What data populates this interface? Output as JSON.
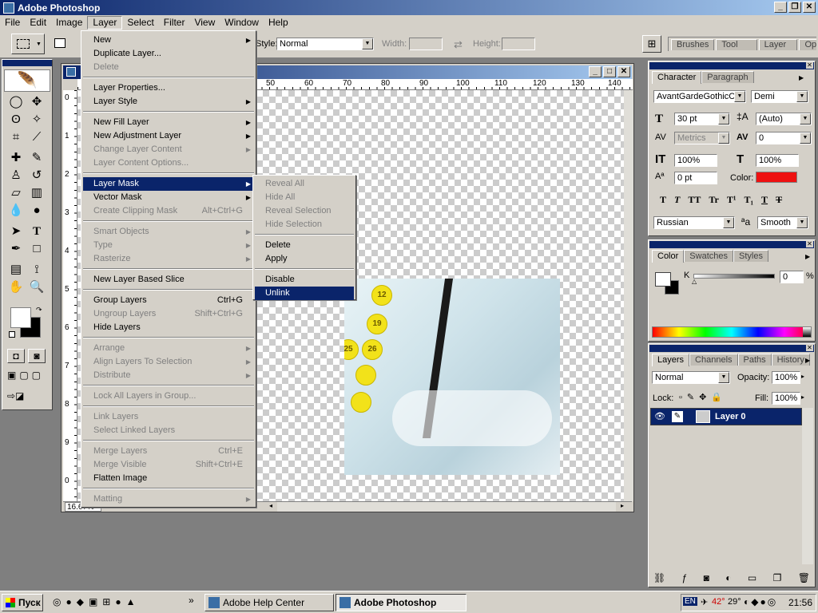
{
  "app": {
    "title": "Adobe Photoshop"
  },
  "menubar": [
    "File",
    "Edit",
    "Image",
    "Layer",
    "Select",
    "Filter",
    "View",
    "Window",
    "Help"
  ],
  "options": {
    "style_label": "Style:",
    "style_value": "Normal",
    "width_label": "Width:",
    "height_label": "Height:",
    "palette_tabs": [
      "Brushes",
      "Tool Presets",
      "Layer Comps",
      "Options"
    ]
  },
  "layer_menu": {
    "items": [
      {
        "label": "New",
        "arrow": true
      },
      {
        "label": "Duplicate Layer..."
      },
      {
        "label": "Delete",
        "disabled": true
      },
      {
        "label": "Layer Properties..."
      },
      {
        "label": "Layer Style",
        "arrow": true
      },
      {
        "label": "New Fill Layer",
        "arrow": true
      },
      {
        "label": "New Adjustment Layer",
        "arrow": true
      },
      {
        "label": "Change Layer Content",
        "disabled": true,
        "arrow": true
      },
      {
        "label": "Layer Content Options...",
        "disabled": true
      },
      {
        "label": "Layer Mask",
        "arrow": true,
        "highlight": true
      },
      {
        "label": "Vector Mask",
        "arrow": true
      },
      {
        "label": "Create Clipping Mask",
        "disabled": true,
        "shortcut": "Alt+Ctrl+G"
      },
      {
        "label": "Smart Objects",
        "disabled": true,
        "arrow": true
      },
      {
        "label": "Type",
        "disabled": true,
        "arrow": true
      },
      {
        "label": "Rasterize",
        "disabled": true,
        "arrow": true
      },
      {
        "label": "New Layer Based Slice"
      },
      {
        "label": "Group Layers",
        "shortcut": "Ctrl+G"
      },
      {
        "label": "Ungroup Layers",
        "disabled": true,
        "shortcut": "Shift+Ctrl+G"
      },
      {
        "label": "Hide Layers"
      },
      {
        "label": "Arrange",
        "disabled": true,
        "arrow": true
      },
      {
        "label": "Align Layers To Selection",
        "disabled": true,
        "arrow": true
      },
      {
        "label": "Distribute",
        "disabled": true,
        "arrow": true
      },
      {
        "label": "Lock All Layers in Group...",
        "disabled": true
      },
      {
        "label": "Link Layers",
        "disabled": true
      },
      {
        "label": "Select Linked Layers",
        "disabled": true
      },
      {
        "label": "Merge Layers",
        "disabled": true,
        "shortcut": "Ctrl+E"
      },
      {
        "label": "Merge Visible",
        "disabled": true,
        "shortcut": "Shift+Ctrl+E"
      },
      {
        "label": "Flatten Image"
      },
      {
        "label": "Matting",
        "disabled": true,
        "arrow": true
      }
    ]
  },
  "mask_submenu": {
    "items": [
      {
        "label": "Reveal All",
        "disabled": true
      },
      {
        "label": "Hide All",
        "disabled": true
      },
      {
        "label": "Reveal Selection",
        "disabled": true
      },
      {
        "label": "Hide Selection",
        "disabled": true
      },
      {
        "label": "Delete"
      },
      {
        "label": "Apply"
      },
      {
        "label": "Disable"
      },
      {
        "label": "Unlink",
        "highlight": true
      }
    ]
  },
  "document": {
    "zoom": "16.67%",
    "status": "Scratch: 223.9M/33 1.0M",
    "ruler_top": [
      "50",
      "60",
      "70",
      "80",
      "90",
      "100",
      "110",
      "120",
      "130",
      "140"
    ],
    "ruler_left": [
      "0",
      "1",
      "2",
      "3",
      "4",
      "5",
      "6",
      "7",
      "8",
      "9",
      "0"
    ],
    "dots": [
      "12",
      "19",
      "25",
      "26"
    ]
  },
  "character": {
    "tabs": [
      "Character",
      "Paragraph"
    ],
    "font": "AvantGardeGothicC",
    "style": "Demi",
    "size": "30 pt",
    "leading": "(Auto)",
    "kerning": "Metrics",
    "tracking": "0",
    "vscale": "100%",
    "hscale": "100%",
    "baseline": "0 pt",
    "color_label": "Color:",
    "color": "#ee1111",
    "styles": [
      "T",
      "T",
      "TT",
      "Tr",
      "T¹",
      "T₁",
      "T",
      "T"
    ],
    "language": "Russian",
    "aa_label": "ªa",
    "antialias": "Smooth"
  },
  "color_panel": {
    "tabs": [
      "Color",
      "Swatches",
      "Styles"
    ],
    "channel": "K",
    "value": "0",
    "unit": "%"
  },
  "layers": {
    "tabs": [
      "Layers",
      "Channels",
      "Paths",
      "History"
    ],
    "blend": "Normal",
    "opacity_label": "Opacity:",
    "opacity": "100%",
    "lock_label": "Lock:",
    "fill_label": "Fill:",
    "fill": "100%",
    "layer_name": "Layer 0"
  },
  "taskbar": {
    "start": "Пуск",
    "tasks": [
      "Adobe Help Center",
      "Adobe Photoshop"
    ],
    "lang": "EN",
    "tray_temps": [
      "42°",
      "29°"
    ],
    "clock": "21:56"
  }
}
